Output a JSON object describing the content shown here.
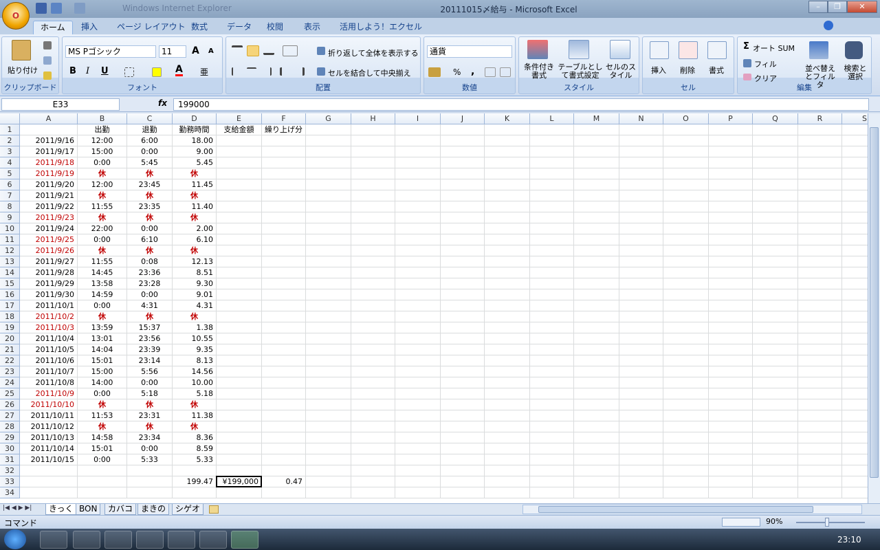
{
  "window": {
    "title": "20111015〆給与 - Microsoft Excel",
    "bg_title": "Windows Internet Explorer"
  },
  "office_button": {
    "label": "O"
  },
  "ribbon_tabs": [
    "ホーム",
    "挿入",
    "ページ レイアウト",
    "数式",
    "データ",
    "校閲",
    "表示",
    "活用しよう！エクセル"
  ],
  "clipboard": {
    "paste": "貼り付け",
    "label": "クリップボード"
  },
  "font": {
    "name": "MS Pゴシック",
    "size": "11",
    "bold": "B",
    "italic": "I",
    "underline": "U",
    "label": "フォント",
    "grow": "A",
    "shrink": "A",
    "color_a": "A",
    "phonetic": "亜"
  },
  "alignment": {
    "wrap": "折り返して全体を表示する",
    "merge": "セルを結合して中央揃え",
    "label": "配置"
  },
  "number": {
    "format": "通貨",
    "percent": "%",
    "comma": ",",
    "label": "数値"
  },
  "style": {
    "conditional": "条件付き書式",
    "table": "テーブルとして書式設定",
    "cell": "セルのスタイル",
    "label": "スタイル"
  },
  "cells": {
    "insert": "挿入",
    "delete": "削除",
    "format": "書式",
    "label": "セル"
  },
  "editing": {
    "autosum": "オート SUM",
    "fill": "フィル",
    "clear": "クリア",
    "sort": "並べ替えとフィルタ",
    "find": "検索と選択",
    "label": "編集"
  },
  "formula_bar": {
    "cell_ref": "E33",
    "fx": "fx",
    "value": "199000"
  },
  "columns": [
    "A",
    "B",
    "C",
    "D",
    "E",
    "F",
    "G",
    "H",
    "I",
    "J",
    "K",
    "L",
    "M",
    "N",
    "O",
    "P",
    "Q",
    "R",
    "S"
  ],
  "header_row": [
    "",
    "出勤",
    "退勤",
    "勤務時間",
    "支給金額",
    "繰り上げ分"
  ],
  "rows": [
    {
      "n": "1"
    },
    {
      "n": "2",
      "a": "2011/9/16",
      "b": "12:00",
      "c": "6:00",
      "d": "18.00"
    },
    {
      "n": "3",
      "a": "2011/9/17",
      "b": "15:00",
      "c": "0:00",
      "d": "9.00"
    },
    {
      "n": "4",
      "a": "2011/9/18",
      "b": "0:00",
      "c": "5:45",
      "d": "5.45",
      "red": true
    },
    {
      "n": "5",
      "a": "2011/9/19",
      "b": "休",
      "c": "休",
      "d": "休",
      "red": true,
      "off": true
    },
    {
      "n": "6",
      "a": "2011/9/20",
      "b": "12:00",
      "c": "23:45",
      "d": "11.45"
    },
    {
      "n": "7",
      "a": "2011/9/21",
      "b": "休",
      "c": "休",
      "d": "休",
      "off": true
    },
    {
      "n": "8",
      "a": "2011/9/22",
      "b": "11:55",
      "c": "23:35",
      "d": "11.40"
    },
    {
      "n": "9",
      "a": "2011/9/23",
      "b": "休",
      "c": "休",
      "d": "休",
      "red": true,
      "off": true
    },
    {
      "n": "10",
      "a": "2011/9/24",
      "b": "22:00",
      "c": "0:00",
      "d": "2.00"
    },
    {
      "n": "11",
      "a": "2011/9/25",
      "b": "0:00",
      "c": "6:10",
      "d": "6.10",
      "red": true
    },
    {
      "n": "12",
      "a": "2011/9/26",
      "b": "休",
      "c": "休",
      "d": "休",
      "red": true,
      "off": true
    },
    {
      "n": "13",
      "a": "2011/9/27",
      "b": "11:55",
      "c": "0:08",
      "d": "12.13"
    },
    {
      "n": "14",
      "a": "2011/9/28",
      "b": "14:45",
      "c": "23:36",
      "d": "8.51"
    },
    {
      "n": "15",
      "a": "2011/9/29",
      "b": "13:58",
      "c": "23:28",
      "d": "9.30"
    },
    {
      "n": "16",
      "a": "2011/9/30",
      "b": "14:59",
      "c": "0:00",
      "d": "9.01"
    },
    {
      "n": "17",
      "a": "2011/10/1",
      "b": "0:00",
      "c": "4:31",
      "d": "4.31"
    },
    {
      "n": "18",
      "a": "2011/10/2",
      "b": "休",
      "c": "休",
      "d": "休",
      "red": true,
      "off": true
    },
    {
      "n": "19",
      "a": "2011/10/3",
      "b": "13:59",
      "c": "15:37",
      "d": "1.38",
      "red": true
    },
    {
      "n": "20",
      "a": "2011/10/4",
      "b": "13:01",
      "c": "23:56",
      "d": "10.55"
    },
    {
      "n": "21",
      "a": "2011/10/5",
      "b": "14:04",
      "c": "23:39",
      "d": "9.35"
    },
    {
      "n": "22",
      "a": "2011/10/6",
      "b": "15:01",
      "c": "23:14",
      "d": "8.13"
    },
    {
      "n": "23",
      "a": "2011/10/7",
      "b": "15:00",
      "c": "5:56",
      "d": "14.56"
    },
    {
      "n": "24",
      "a": "2011/10/8",
      "b": "14:00",
      "c": "0:00",
      "d": "10.00"
    },
    {
      "n": "25",
      "a": "2011/10/9",
      "b": "0:00",
      "c": "5:18",
      "d": "5.18",
      "red": true
    },
    {
      "n": "26",
      "a": "2011/10/10",
      "b": "休",
      "c": "休",
      "d": "休",
      "red": true,
      "off": true
    },
    {
      "n": "27",
      "a": "2011/10/11",
      "b": "11:53",
      "c": "23:31",
      "d": "11.38"
    },
    {
      "n": "28",
      "a": "2011/10/12",
      "b": "休",
      "c": "休",
      "d": "休",
      "off": true
    },
    {
      "n": "29",
      "a": "2011/10/13",
      "b": "14:58",
      "c": "23:34",
      "d": "8.36"
    },
    {
      "n": "30",
      "a": "2011/10/14",
      "b": "15:01",
      "c": "0:00",
      "d": "8.59"
    },
    {
      "n": "31",
      "a": "2011/10/15",
      "b": "0:00",
      "c": "5:33",
      "d": "5.33"
    },
    {
      "n": "32"
    },
    {
      "n": "33",
      "d": "199.47",
      "e": "¥199,000",
      "f": "0.47"
    },
    {
      "n": "34"
    }
  ],
  "sheet_tabs": [
    "きっく",
    "BON",
    "カバコ",
    "まきの",
    "シゲオ"
  ],
  "status": {
    "mode": "コマンド",
    "zoom": "90%"
  },
  "taskbar": {
    "clock": "23:10"
  }
}
